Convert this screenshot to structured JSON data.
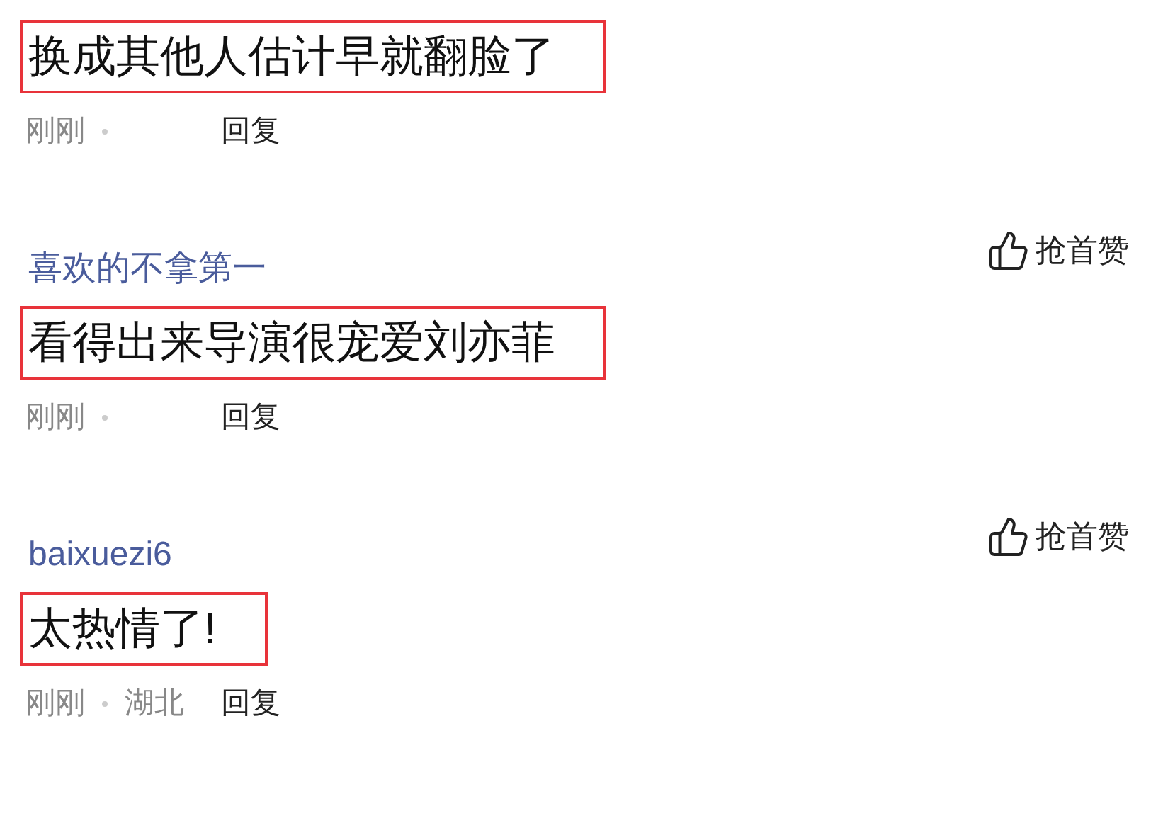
{
  "comments": [
    {
      "text": "换成其他人估计早就翻脸了",
      "highlighted": true,
      "time": "刚刚",
      "reply": "回复"
    },
    {
      "user": "喜欢的不拿第一",
      "like": "抢首赞",
      "text": "看得出来导演很宠爱刘亦菲",
      "highlighted": true,
      "time": "刚刚",
      "reply": "回复"
    },
    {
      "user": "baixuezi6",
      "like": "抢首赞",
      "text": "太热情了!",
      "highlighted": true,
      "time": "刚刚",
      "location": "湖北",
      "reply": "回复"
    }
  ]
}
